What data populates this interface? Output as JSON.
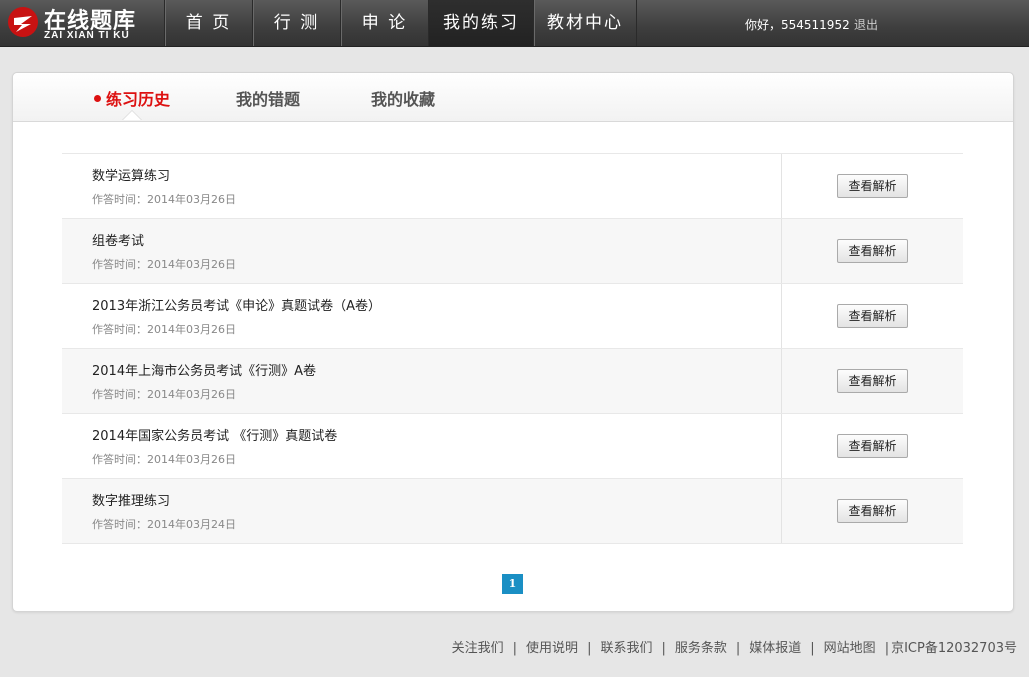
{
  "header": {
    "logo_title": "在线题库",
    "logo_sub": "ZAI XIAN TI KU",
    "nav": [
      {
        "label": "首 页"
      },
      {
        "label": "行 测"
      },
      {
        "label": "申 论"
      },
      {
        "label": "我的练习"
      },
      {
        "label": "教材中心"
      }
    ],
    "greeting": "你好，554511952",
    "logout": "退出"
  },
  "tabs": [
    {
      "label": "练习历史"
    },
    {
      "label": "我的错题"
    },
    {
      "label": "我的收藏"
    }
  ],
  "records": [
    {
      "title": "数学运算练习",
      "time": "作答时间：2014年03月26日",
      "action": "查看解析"
    },
    {
      "title": "组卷考试",
      "time": "作答时间：2014年03月26日",
      "action": "查看解析"
    },
    {
      "title": "2013年浙江公务员考试《申论》真题试卷（A卷）",
      "time": "作答时间：2014年03月26日",
      "action": "查看解析"
    },
    {
      "title": "2014年上海市公务员考试《行测》A卷",
      "time": "作答时间：2014年03月26日",
      "action": "查看解析"
    },
    {
      "title": "2014年国家公务员考试 《行测》真题试卷",
      "time": "作答时间：2014年03月26日",
      "action": "查看解析"
    },
    {
      "title": "数字推理练习",
      "time": "作答时间：2014年03月24日",
      "action": "查看解析"
    }
  ],
  "pagination": {
    "current": "1"
  },
  "footer": {
    "links": [
      "关注我们",
      "使用说明",
      "联系我们",
      "服务条款",
      "媒体报道",
      "网站地图"
    ],
    "icp": "京ICP备12032703号"
  },
  "colors": {
    "accent_red": "#dd1111",
    "pager_blue": "#1a8fc4"
  }
}
